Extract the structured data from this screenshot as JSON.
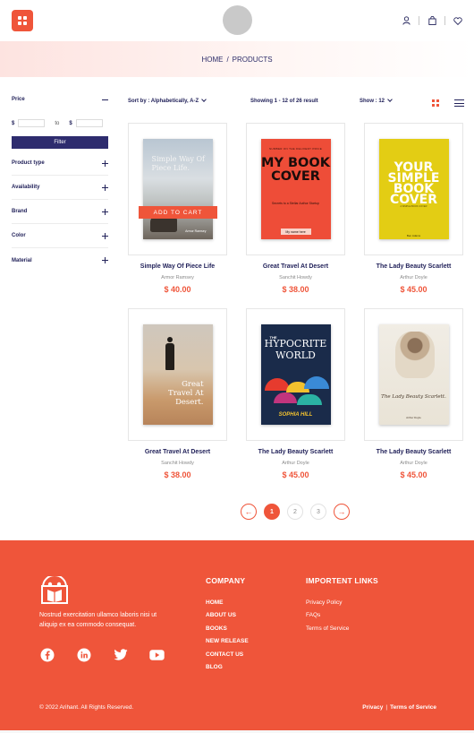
{
  "header": {
    "icons": [
      "grid-menu-icon",
      "user-icon",
      "shopping-bag-icon",
      "heart-icon"
    ]
  },
  "breadcrumb": {
    "home": "HOME",
    "separator": "/",
    "current": "PRODUCTS"
  },
  "sidebar": {
    "price_label": "Price",
    "currency": "$",
    "to_label": "to",
    "filter_button": "Filter",
    "facets": [
      "Product type",
      "Availability",
      "Brand",
      "Color",
      "Material"
    ]
  },
  "toolbar": {
    "sort_label": "Sort by : Alphabetically, A-Z",
    "showing": "Showing 1 - 12 of 26 result",
    "show_label": "Show : 12"
  },
  "products": [
    {
      "name": "Simple Way Of Piece Life",
      "author": "Armor Ramsey",
      "price": "$ 40.00",
      "cart_label": "ADD TO CART",
      "cover": {
        "title": "Simple Way Of Piece Life.",
        "byline": "Armor Ramsey"
      }
    },
    {
      "name": "Great Travel At Desert",
      "author": "Sanchit Howdy",
      "price": "$ 38.00",
      "cover": {
        "small": "NUMBER ON THE DELIVERY PRICE",
        "title": "MY BOOK COVER",
        "subtitle": "Secrets to a Stellar Author Startup",
        "byline": "My name here"
      }
    },
    {
      "name": "The Lady Beauty Scarlett",
      "author": "Arthur Doyle",
      "price": "$ 45.00",
      "cover": {
        "title": "YOUR SIMPLE BOOK COVER",
        "small": "A SIMPLE BOOK COVER",
        "byline": "Ben Adams"
      }
    },
    {
      "name": "Great Travel At Desert",
      "author": "Sanchit Howdy",
      "price": "$ 38.00",
      "cover": {
        "title": "Great Travel At Desert."
      }
    },
    {
      "name": "The Lady Beauty Scarlett",
      "author": "Arthur Doyle",
      "price": "$ 45.00",
      "cover": {
        "the": "THE",
        "title": "HYPOCRITE WORLD",
        "byline": "SOPHIA HILL"
      }
    },
    {
      "name": "The Lady Beauty Scarlett",
      "author": "Arthur Doyle",
      "price": "$ 45.00",
      "cover": {
        "title": "The Lady Beauty Scarlett.",
        "byline": "Arthur Doyle"
      }
    }
  ],
  "pagination": {
    "prev": "←",
    "pages": [
      "1",
      "2",
      "3"
    ],
    "active": "1",
    "next": "→"
  },
  "footer": {
    "description": "Nostrud exercitation ullamco laboris nisi ut aliquip ex ea commodo consequat.",
    "socials": [
      "facebook-icon",
      "linkedin-icon",
      "twitter-icon",
      "youtube-icon"
    ],
    "company": {
      "heading": "COMPANY",
      "links": [
        "HOME",
        "ABOUT US",
        "BOOKS",
        "NEW RELEASE",
        "CONTACT US",
        "BLOG"
      ]
    },
    "important": {
      "heading": "IMPORTENT LINKS",
      "links": [
        "Privacy Policy",
        "FAQs",
        "Terms of Service"
      ]
    },
    "copyright": "© 2022 Arihant. All Rights Reserved.",
    "privacy": "Privacy",
    "legal_separator": "|",
    "terms": "Terms of Service"
  },
  "colors": {
    "accent": "#ef553a",
    "navy": "#2e2c6e"
  }
}
